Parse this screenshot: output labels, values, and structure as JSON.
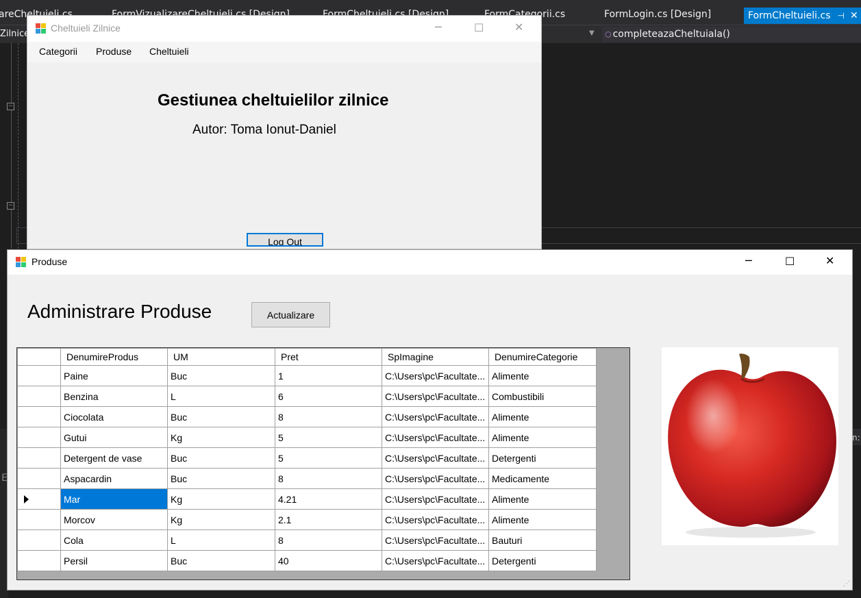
{
  "ide": {
    "tabs": [
      {
        "label": "areCheltuieli.cs"
      },
      {
        "label": "FormVizualizareCheltuieli.cs [Design]"
      },
      {
        "label": "FormCheltuieli.cs [Design]"
      },
      {
        "label": "FormCategorii.cs"
      },
      {
        "label": "FormLogin.cs [Design]"
      },
      {
        "label": "FormCheltuieli.cs"
      }
    ],
    "nav_left": "Zilnice",
    "member_combo": "completeazaCheltuiala()",
    "edge_text": "n:",
    "left_letter": "E",
    "colors": {
      "accent": "#007acc",
      "bg": "#1e1e1e"
    }
  },
  "window1": {
    "title": "Cheltuieli Zilnice",
    "menu": [
      "Categorii",
      "Produse",
      "Cheltuieli"
    ],
    "heading": "Gestiunea cheltuielilor zilnice",
    "author": "Autor: Toma Ionut-Daniel",
    "logout_label": "Log Out"
  },
  "window2": {
    "title": "Produse",
    "heading": "Administrare Produse",
    "refresh_label": "Actualizare",
    "grid": {
      "columns": [
        "DenumireProdus",
        "UM",
        "Pret",
        "SpImagine",
        "DenumireCategorie"
      ],
      "selected_row": 6,
      "rows": [
        [
          "Paine",
          "Buc",
          "1",
          "C:\\Users\\pc\\Facultate...",
          "Alimente"
        ],
        [
          "Benzina",
          "L",
          "6",
          "C:\\Users\\pc\\Facultate...",
          "Combustibili"
        ],
        [
          "Ciocolata",
          "Buc",
          "8",
          "C:\\Users\\pc\\Facultate...",
          "Alimente"
        ],
        [
          "Gutui",
          "Kg",
          "5",
          "C:\\Users\\pc\\Facultate...",
          "Alimente"
        ],
        [
          "Detergent de vase",
          "Buc",
          "5",
          "C:\\Users\\pc\\Facultate...",
          "Detergenti"
        ],
        [
          "Aspacardin",
          "Buc",
          "8",
          "C:\\Users\\pc\\Facultate...",
          "Medicamente"
        ],
        [
          "Mar",
          "Kg",
          "4.21",
          "C:\\Users\\pc\\Facultate...",
          "Alimente"
        ],
        [
          "Morcov",
          "Kg",
          "2.1",
          "C:\\Users\\pc\\Facultate...",
          "Alimente"
        ],
        [
          "Cola",
          "L",
          "8",
          "C:\\Users\\pc\\Facultate...",
          "Bauturi"
        ],
        [
          "Persil",
          "Buc",
          "40",
          "C:\\Users\\pc\\Facultate...",
          "Detergenti"
        ]
      ]
    },
    "image": {
      "icon": "apple-image",
      "subject": "red apple"
    }
  }
}
